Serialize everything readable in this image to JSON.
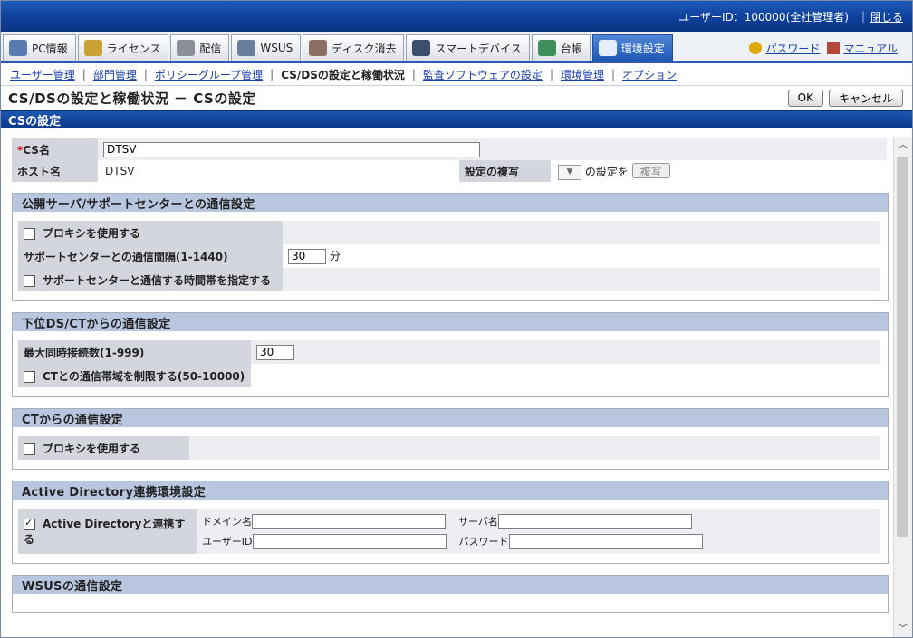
{
  "header": {
    "user_id_text": "ユーザーID：100000(全社管理者)",
    "close_link": "閉じる"
  },
  "tabs": [
    {
      "label": "PC情報",
      "icon": "pc-icon",
      "color": "#5a7bb0"
    },
    {
      "label": "ライセンス",
      "icon": "license-icon",
      "color": "#c9a233"
    },
    {
      "label": "配信",
      "icon": "distribution-icon",
      "color": "#8a8f98"
    },
    {
      "label": "WSUS",
      "icon": "wsus-icon",
      "color": "#6b7d9c"
    },
    {
      "label": "ディスク消去",
      "icon": "disk-erase-icon",
      "color": "#8d6e63"
    },
    {
      "label": "スマートデバイス",
      "icon": "smart-device-icon",
      "color": "#3c4f6e"
    },
    {
      "label": "台帳",
      "icon": "ledger-icon",
      "color": "#3f8f5a"
    },
    {
      "label": "環境設定",
      "icon": "settings-tools-icon",
      "color": "#e6eefc",
      "active": true
    }
  ],
  "tab_links": {
    "password": "パスワード",
    "manual": "マニュアル"
  },
  "subnav": [
    {
      "label": "ユーザー管理",
      "link": true
    },
    {
      "label": "部門管理",
      "link": true
    },
    {
      "label": "ポリシーグループ管理",
      "link": true
    },
    {
      "label": "CS/DSの設定と稼働状況",
      "link": false
    },
    {
      "label": "監査ソフトウェアの設定",
      "link": true
    },
    {
      "label": "環境管理",
      "link": true
    },
    {
      "label": "オプション",
      "link": true
    }
  ],
  "page_title": "CS/DSの設定と稼働状況 － CSの設定",
  "buttons": {
    "ok": "OK",
    "cancel": "キャンセル"
  },
  "section_title": "CSの設定",
  "basic": {
    "cs_name_label": "CS名",
    "cs_name_value": "DTSV",
    "host_label": "ホスト名",
    "host_value": "DTSV",
    "copy_label": "設定の複写",
    "copy_suffix": "の設定を",
    "copy_button": "複写"
  },
  "public": {
    "title": "公開サーバ/サポートセンターとの通信設定",
    "proxy": "プロキシを使用する",
    "interval_label": "サポートセンターとの通信間隔(1-1440)",
    "interval_value": "30",
    "interval_unit": "分",
    "timeband": "サポートセンターと通信する時間帯を指定する"
  },
  "lower": {
    "title": "下位DS/CTからの通信設定",
    "max_label": "最大同時接続数(1-999)",
    "max_value": "30",
    "bandwidth": "CTとの通信帯域を制限する(50-10000)"
  },
  "ct": {
    "title": "CTからの通信設定",
    "proxy": "プロキシを使用する"
  },
  "ad": {
    "title": "Active Directory連携環境設定",
    "link": "Active Directoryと連携する",
    "domain": "ドメイン名",
    "server": "サーバ名",
    "user": "ユーザーID",
    "password": "パスワード"
  },
  "wsus": {
    "title": "WSUSの通信設定"
  }
}
